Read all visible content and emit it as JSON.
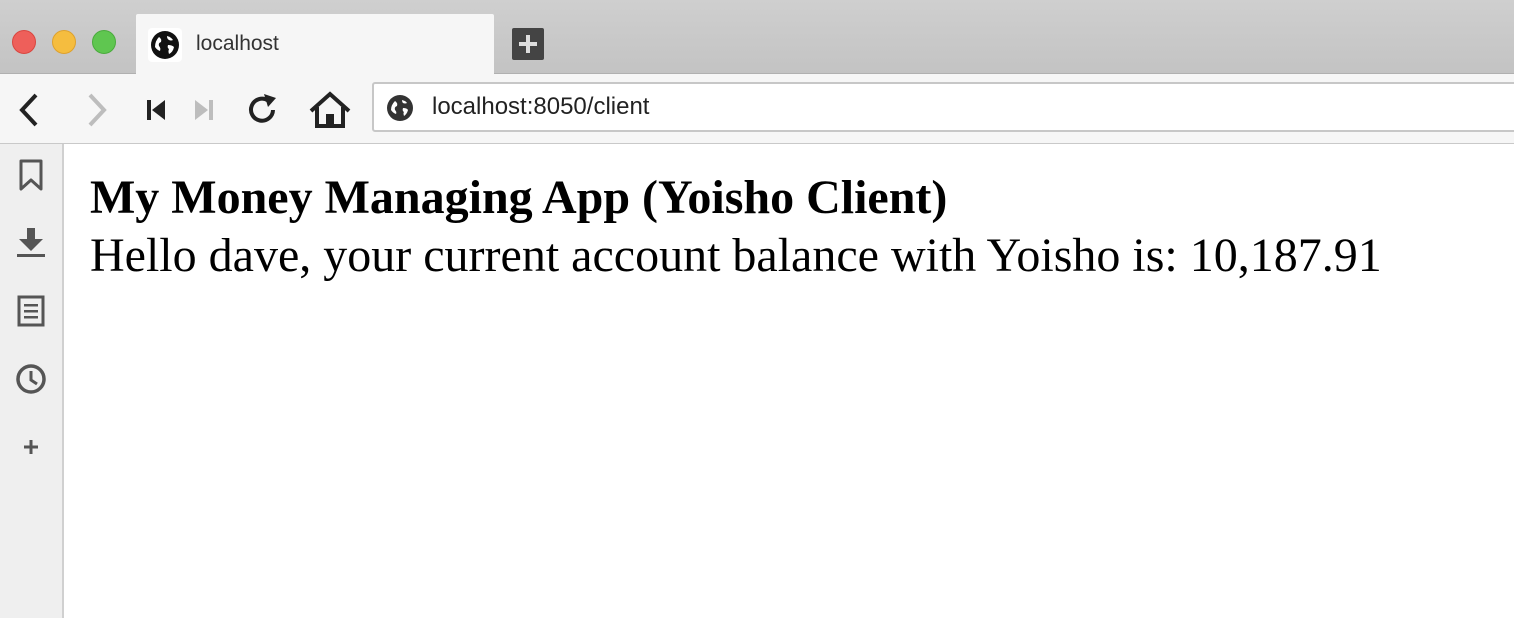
{
  "window": {
    "controls": [
      "close",
      "minimize",
      "maximize"
    ]
  },
  "tab": {
    "title": "localhost",
    "favicon": "globe-icon"
  },
  "toolbar": {
    "icons": [
      "back-icon",
      "forward-icon",
      "skip-back-icon",
      "skip-forward-icon",
      "reload-icon",
      "home-icon"
    ]
  },
  "urlbar": {
    "value": "localhost:8050/client",
    "icon": "globe-icon"
  },
  "sidebar": {
    "icons": [
      "bookmark-icon",
      "download-icon",
      "notes-icon",
      "history-icon",
      "plus-icon"
    ]
  },
  "page": {
    "title": "My Money Managing App (Yoisho Client)",
    "greeting": "Hello dave, your current account balance with Yoisho is: 10,187.91"
  },
  "colors": {
    "close": "#ee5f5a",
    "minimize": "#f5bd3f",
    "maximize": "#5fc650"
  }
}
